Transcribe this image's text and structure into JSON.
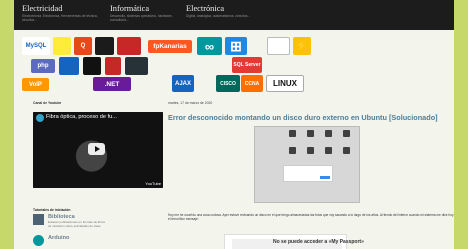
{
  "nav": [
    {
      "title": "Electricidad",
      "description": "Electrotécnia, Electrónica, Herramientas de técnica, circuitos..."
    },
    {
      "title": "Informática",
      "description": "Desarrollo, sistemas operativos, hardware, consultoría..."
    },
    {
      "title": "Electrónica",
      "description": "Digital, analógica, automatismos, circuitos..."
    }
  ],
  "logos": [
    {
      "name": "mysql-logo",
      "label": "MySQL",
      "color": "#ffffff"
    },
    {
      "name": "electric-logo",
      "label": "",
      "color": "#ffeb3b"
    },
    {
      "name": "q-logo",
      "label": "Q",
      "color": "#e64a19"
    },
    {
      "name": "terminal-logo",
      "label": "",
      "color": "#1b1b1b"
    },
    {
      "name": "pixel-logo",
      "label": "",
      "color": "#c62828"
    },
    {
      "name": "fpkanarias-logo",
      "label": "fpKanarias",
      "color": "#ff5722"
    },
    {
      "name": "arduino-logo",
      "label": "∞",
      "color": "#00979d"
    },
    {
      "name": "windows-logo",
      "label": "⊞",
      "color": "#1e88e5"
    },
    {
      "name": "grid-logo",
      "label": "",
      "color": "#ffffff"
    },
    {
      "name": "electrical-logo",
      "label": "⚡",
      "color": "#ffc107"
    },
    {
      "name": "php-logo",
      "label": "php",
      "color": "#5c6bc0"
    },
    {
      "name": "crown-logo",
      "label": "",
      "color": "#1565c0"
    },
    {
      "name": "linux-tux-logo",
      "label": "",
      "color": "#111111"
    },
    {
      "name": "raspberry-logo",
      "label": "",
      "color": "#c62828"
    },
    {
      "name": "code-logo",
      "label": "",
      "color": "#263238"
    },
    {
      "name": "sql-server-logo",
      "label": "SQL Server",
      "color": "#e53935"
    },
    {
      "name": "ajax-logo",
      "label": "AJAX",
      "color": "#1565c0"
    },
    {
      "name": "cisco-logo",
      "label": "CISCO",
      "color": "#00695c"
    },
    {
      "name": "linux-foundation-logo",
      "label": "LINUX",
      "color": "#ffffff"
    },
    {
      "name": "voip-logo",
      "label": "VoIP",
      "color": "#ff9800"
    },
    {
      "name": "dotnet-logo",
      "label": ".NET",
      "color": "#6a1b9a"
    },
    {
      "name": "ccna-logo",
      "label": "CCNA",
      "color": "#ff6f00"
    }
  ],
  "sidebar": {
    "youtube_title": "Canal de Youtube",
    "video_title": "Fibra óptica, proceso de fu...",
    "youtube_label": "YouTube",
    "tutorials_title": "Tutoriales de iniciación",
    "items": [
      {
        "name": "Biblioteca",
        "description": "Enlaces publicaciones en formato de libros de iniciación sobre actividades de clase"
      },
      {
        "name": "Arduino",
        "description": ""
      }
    ]
  },
  "post": {
    "date": "martes, 17 de marzo de 2020",
    "title": "Error desconocido montando un disco duro externo en Ubuntu [Solucionado]",
    "body": "Hoy me he ocurrido una cosa curiosa. Ayer estuve revisando un disco en el que tengo almacenadas las fotos que voy sacando a lo largo de los años. Al tiendo del interior cuando mi sistema me dice hoy el terrorífico mensaje:",
    "warning": "No se puede acceder a «My Passport»"
  }
}
